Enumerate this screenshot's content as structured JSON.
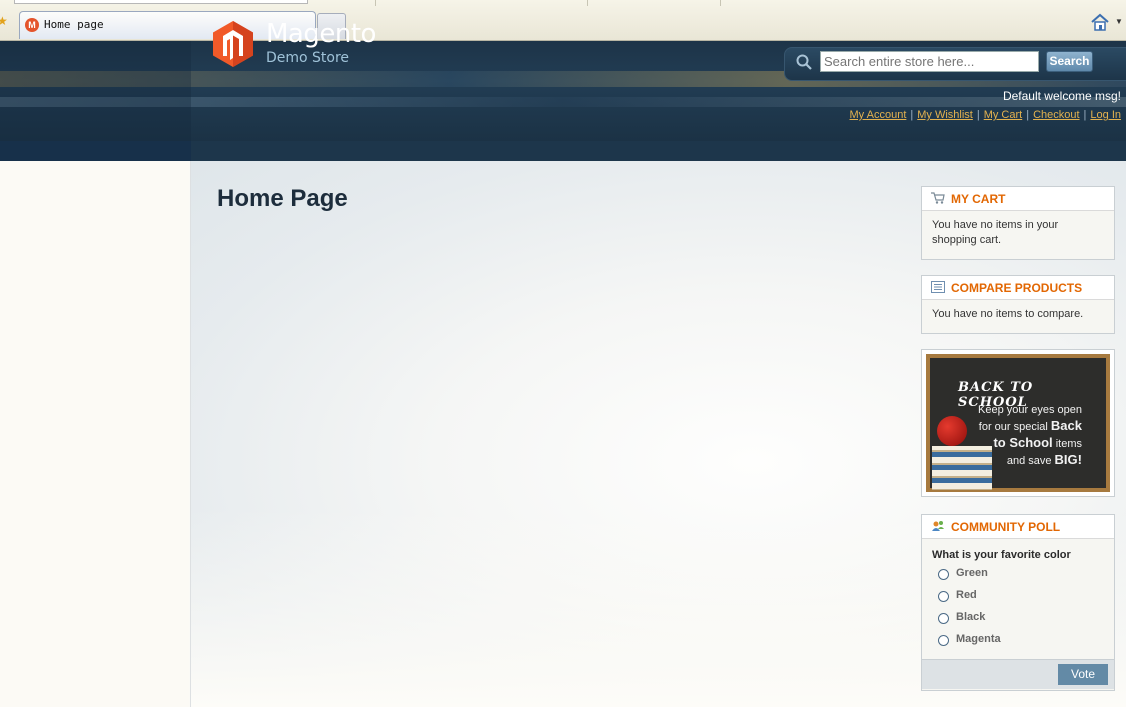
{
  "browser": {
    "tab_title": "Home page"
  },
  "header": {
    "logo_main": "Magento",
    "logo_sub": "Demo Store",
    "search_placeholder": "Search entire store here...",
    "search_button": "Search",
    "welcome": "Default welcome msg!",
    "links": [
      "My Account",
      "My Wishlist",
      "My Cart",
      "Checkout",
      "Log In"
    ]
  },
  "main": {
    "page_title": "Home Page"
  },
  "sidebar": {
    "cart": {
      "title": "MY CART",
      "message": "You have no items in your shopping cart."
    },
    "compare": {
      "title": "COMPARE PRODUCTS",
      "message": "You have no items to compare."
    },
    "promo": {
      "title": "BACK TO SCHOOL",
      "line1": "Keep your eyes open",
      "line2a": "for our special",
      "line2b": "Back",
      "line3a": "to School",
      "line3b": "items",
      "line4a": "and save",
      "line4b": "BIG!"
    },
    "poll": {
      "title": "COMMUNITY POLL",
      "question": "What is your favorite color",
      "options": [
        "Green",
        "Red",
        "Black",
        "Magenta"
      ],
      "vote_button": "Vote"
    }
  },
  "colors": {
    "accent_orange": "#e26703",
    "header_navy": "#1d3448",
    "link_gold": "#e3b24f",
    "vote_blue": "#638aa6"
  }
}
